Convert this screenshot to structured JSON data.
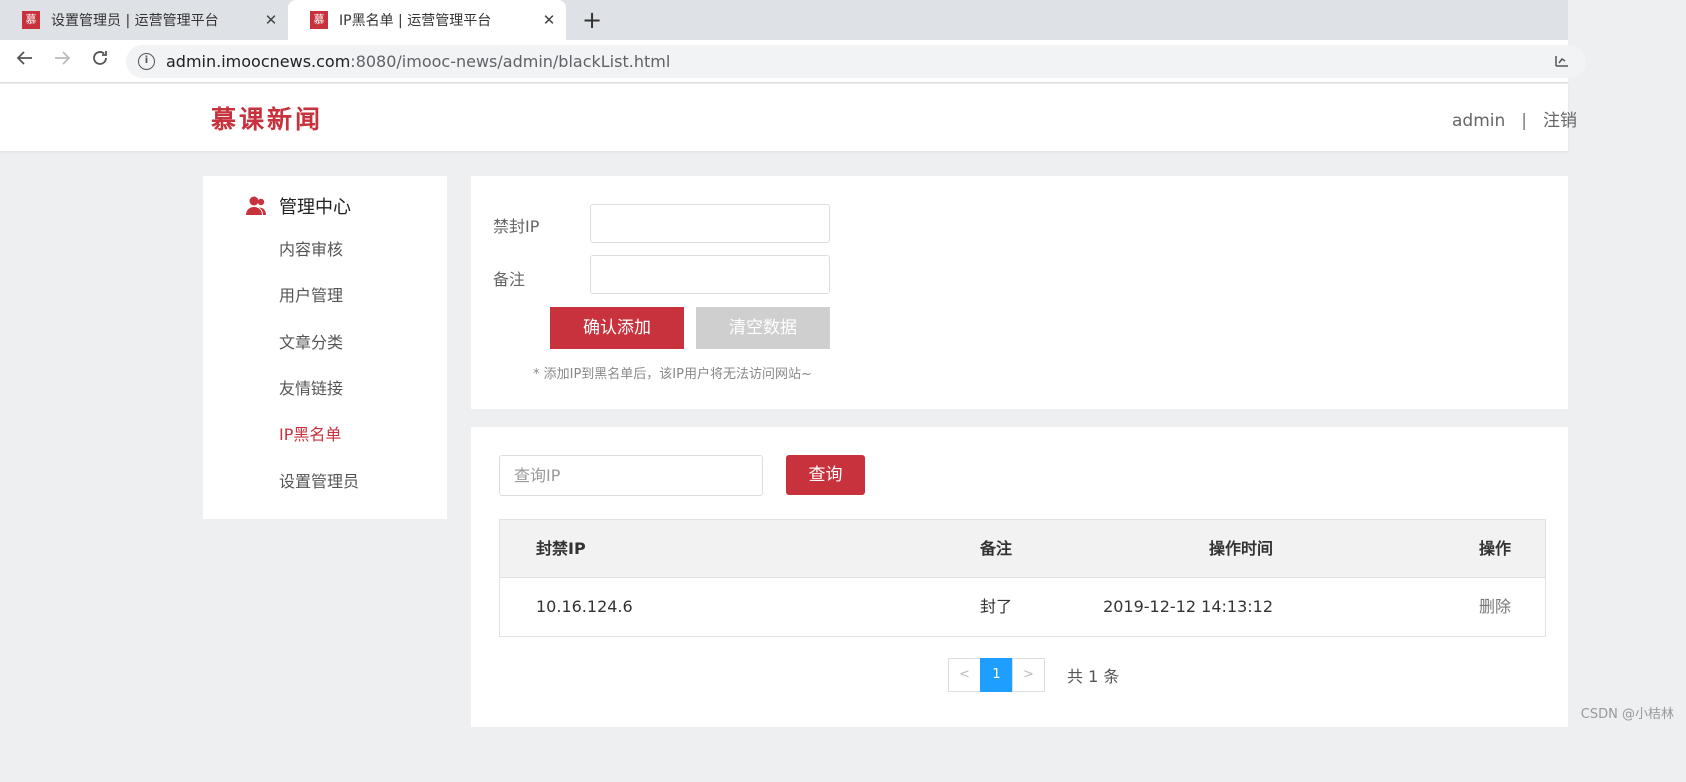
{
  "browser": {
    "tabs": [
      {
        "favicon": "慕",
        "title": "设置管理员 | 运营管理平台",
        "active": false
      },
      {
        "favicon": "慕",
        "title": "IP黑名单 | 运营管理平台",
        "active": true
      }
    ],
    "close_glyph": "✕",
    "new_tab_glyph": "+",
    "url_host": "admin.imoocnews.com",
    "url_rest": ":8080/imooc-news/admin/blackList.html"
  },
  "header": {
    "logo": "慕课新闻",
    "username": "admin",
    "separator": "|",
    "logout": "注销"
  },
  "sidebar": {
    "title": "管理中心",
    "items": [
      {
        "label": "内容审核"
      },
      {
        "label": "用户管理"
      },
      {
        "label": "文章分类"
      },
      {
        "label": "友情链接"
      },
      {
        "label": "IP黑名单",
        "active": true
      },
      {
        "label": "设置管理员"
      }
    ]
  },
  "form": {
    "ip_label": "禁封IP",
    "ip_value": "",
    "remark_label": "备注",
    "remark_value": "",
    "confirm_label": "确认添加",
    "clear_label": "清空数据",
    "hint": "* 添加IP到黑名单后，该IP用户将无法访问网站~"
  },
  "list": {
    "search_placeholder": "查询IP",
    "search_button": "查询",
    "columns": [
      "封禁IP",
      "备注",
      "操作时间",
      "操作"
    ],
    "rows": [
      {
        "ip": "10.16.124.6",
        "remark": "封了",
        "time": "2019-12-12 14:13:12",
        "action": "删除"
      }
    ],
    "pager": {
      "prev": "<",
      "current": "1",
      "next": ">",
      "total": "共 1 条"
    }
  },
  "colors": {
    "accent": "#c7323d",
    "pager_active": "#1e9fff"
  },
  "watermark": "CSDN @小桔林"
}
